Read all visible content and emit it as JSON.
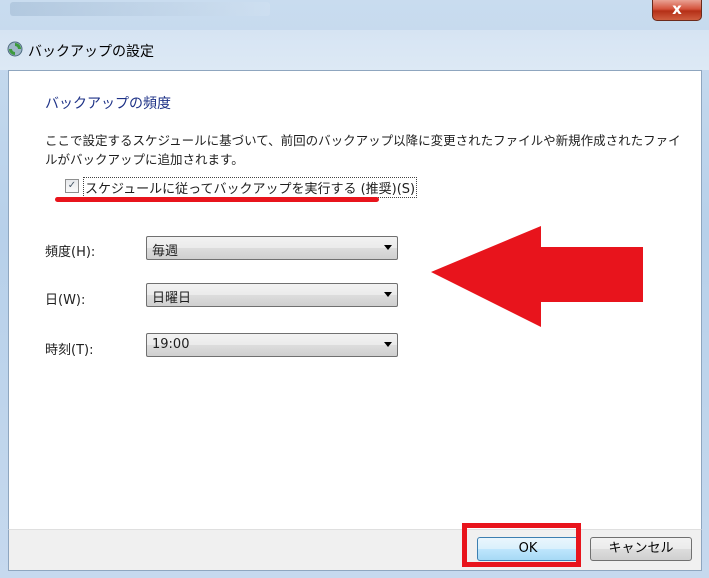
{
  "window": {
    "close_label": "x",
    "title": "バックアップの設定"
  },
  "content": {
    "heading": "バックアップの頻度",
    "description": "ここで設定するスケジュールに基づいて、前回のバックアップ以降に変更されたファイルや新規作成されたファイルがバックアップに追加されます。",
    "schedule_checkbox": {
      "label": "スケジュールに従ってバックアップを実行する (推奨)(S)",
      "checked": true,
      "check_glyph": "✓"
    },
    "fields": {
      "frequency": {
        "label": "頻度(H):",
        "value": "毎週"
      },
      "day": {
        "label": "日(W):",
        "value": "日曜日"
      },
      "time": {
        "label": "時刻(T):",
        "value": "19:00"
      }
    }
  },
  "buttons": {
    "ok": "OK",
    "cancel": "キャンセル"
  },
  "annotations": {
    "color": "#e8141c",
    "arrow_icon": "left-arrow"
  }
}
